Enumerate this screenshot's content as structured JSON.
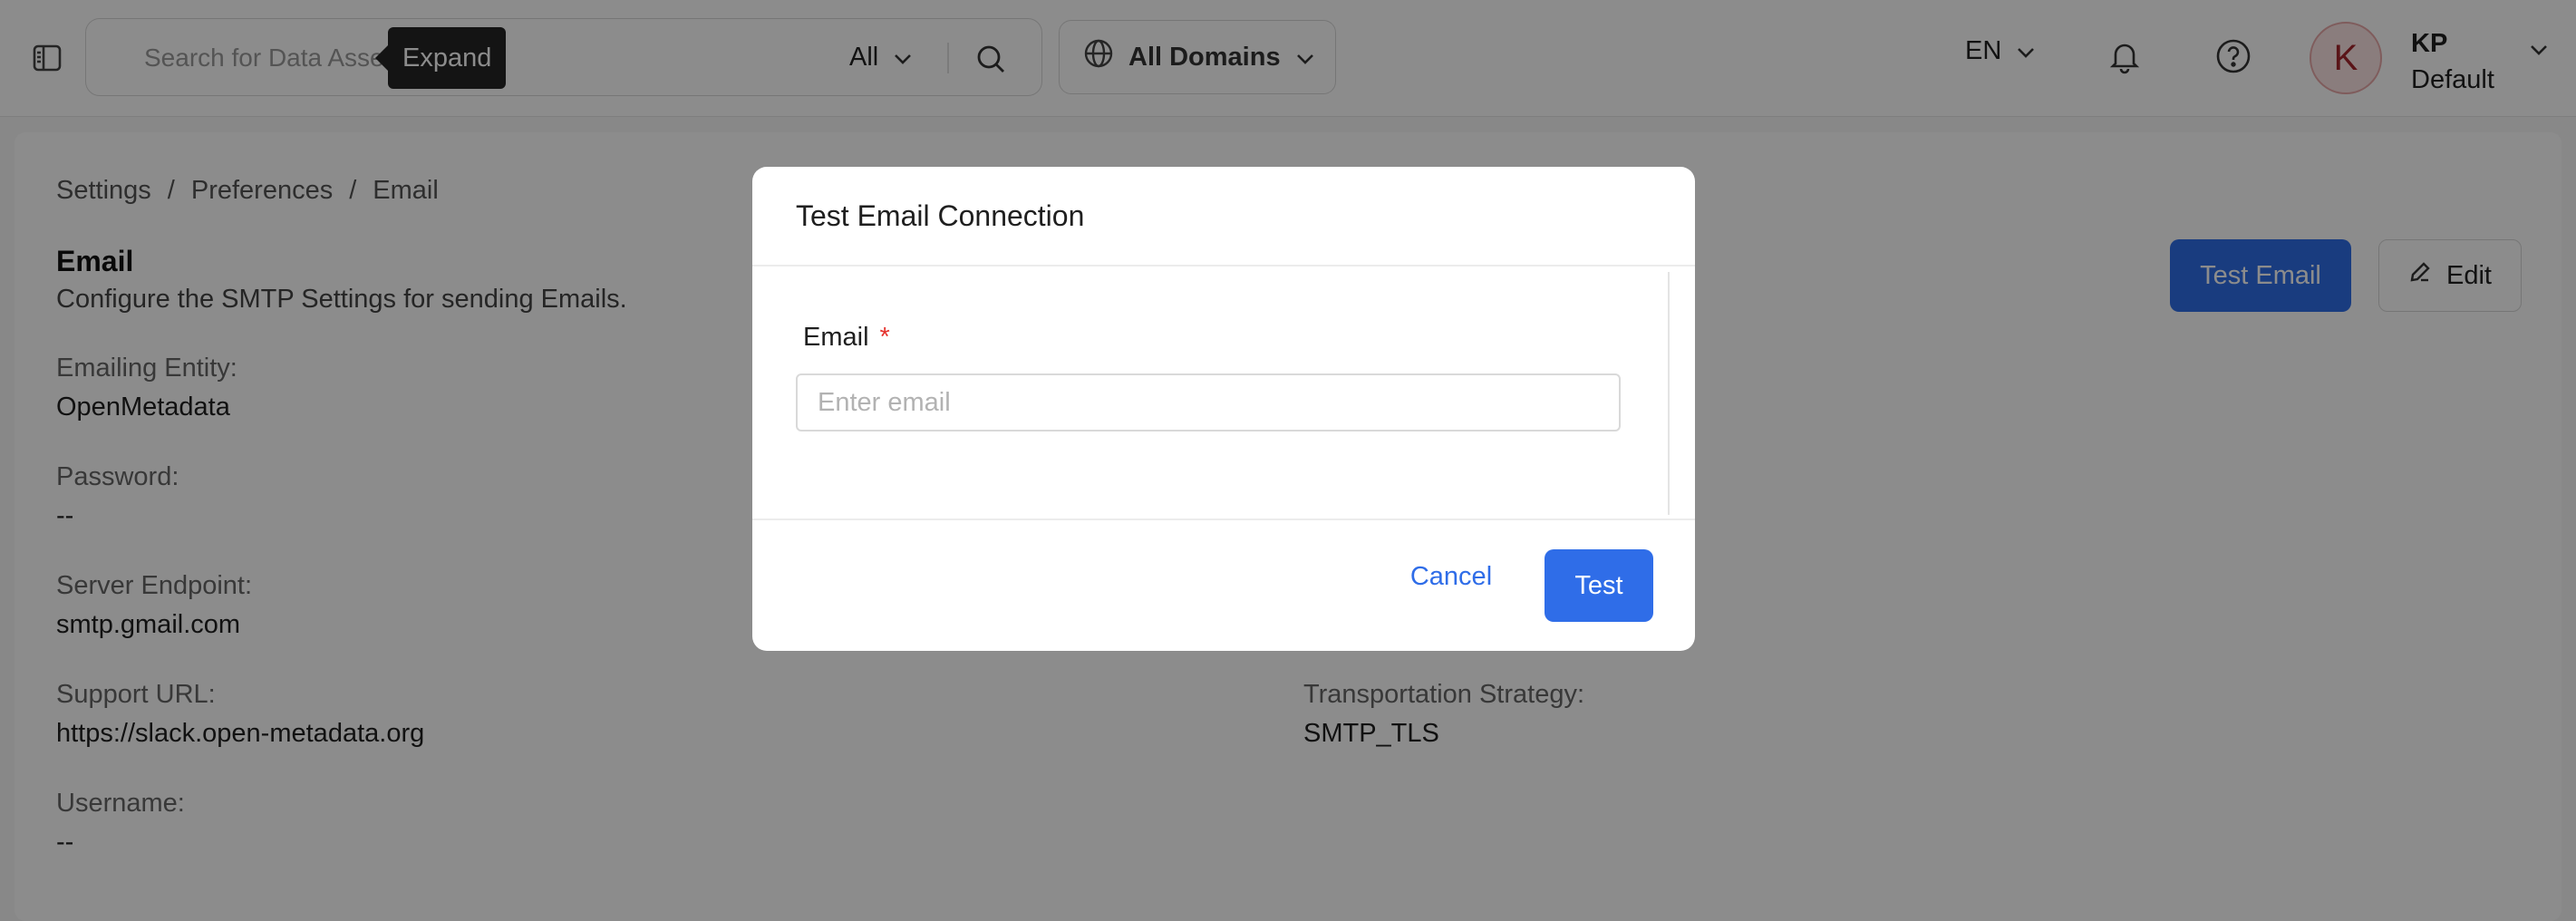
{
  "header": {
    "search": {
      "placeholder": "Search for Data Assets"
    },
    "tooltip": "Expand",
    "search_filter": "All",
    "domain_select": "All Domains",
    "language": "EN",
    "user": {
      "avatar_letter": "K",
      "initials": "KP",
      "role": "Default"
    }
  },
  "breadcrumb": [
    "Settings",
    "/",
    "Preferences",
    "/",
    "Email"
  ],
  "page": {
    "title": "Email",
    "description": "Configure the SMTP Settings for sending Emails.",
    "test_email_label": "Test Email",
    "edit_label": "Edit"
  },
  "fields": [
    {
      "label": "Emailing Entity:",
      "value": "OpenMetadata"
    },
    {
      "label": "Password:",
      "value": "--"
    },
    {
      "label": "Server Endpoint:",
      "value": "smtp.gmail.com"
    },
    {
      "label": "Support URL:",
      "value": "https://slack.open-metadata.org"
    },
    {
      "label": "Username:",
      "value": "--"
    },
    {
      "label": "Transportation Strategy:",
      "value": "SMTP_TLS"
    }
  ],
  "modal": {
    "title": "Test Email Connection",
    "email_label": "Email",
    "required_mark": "*",
    "email_placeholder": "Enter email",
    "cancel_label": "Cancel",
    "test_label": "Test"
  },
  "colors": {
    "primary": "#2f6de8",
    "avatar_bg": "#fbe3e3",
    "avatar_text": "#a4262c",
    "required": "#e5322d",
    "overlay": "rgba(0,0,0,0.45)"
  }
}
